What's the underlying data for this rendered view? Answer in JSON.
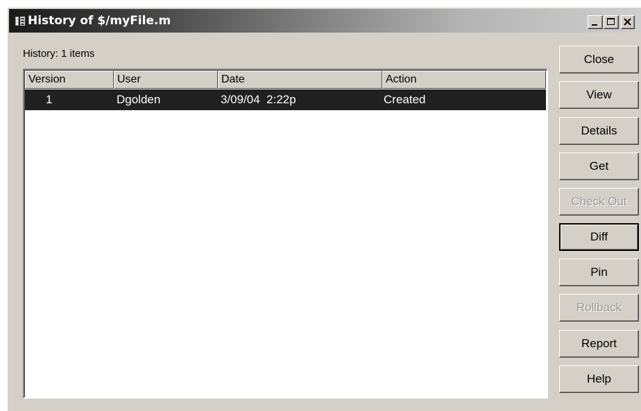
{
  "window": {
    "title": "History of $/myFile.m",
    "title_colors": [
      "#1a1a1a",
      "#cfcfcf"
    ],
    "controls": [
      "minimize-icon",
      "maximize-icon",
      "close-icon"
    ]
  },
  "history_label": "History: 1 items",
  "table": {
    "columns": [
      "Version",
      "User",
      "Date",
      "Action"
    ],
    "rows": [
      {
        "version": "1",
        "user": "Dgolden",
        "date": "3/09/04  2:22p",
        "action": "Created",
        "selected": true
      }
    ]
  },
  "buttons": {
    "close": {
      "label": "Close",
      "enabled": true
    },
    "view": {
      "label": "View",
      "enabled": true
    },
    "details": {
      "label": "Details",
      "enabled": true
    },
    "get": {
      "label": "Get",
      "enabled": true
    },
    "check_out": {
      "label": "Check Out",
      "enabled": false
    },
    "diff": {
      "label": "Diff",
      "enabled": true,
      "default": true
    },
    "pin": {
      "label": "Pin",
      "enabled": true
    },
    "rollback": {
      "label": "Rollback",
      "enabled": false
    },
    "report": {
      "label": "Report",
      "enabled": true
    },
    "help": {
      "label": "Help",
      "enabled": true
    }
  },
  "colors": {
    "window_bg": "#d4d0c8",
    "selection_bg": "#202020",
    "selection_text": "#ffffff",
    "disabled_text": "#9a9a9a"
  }
}
